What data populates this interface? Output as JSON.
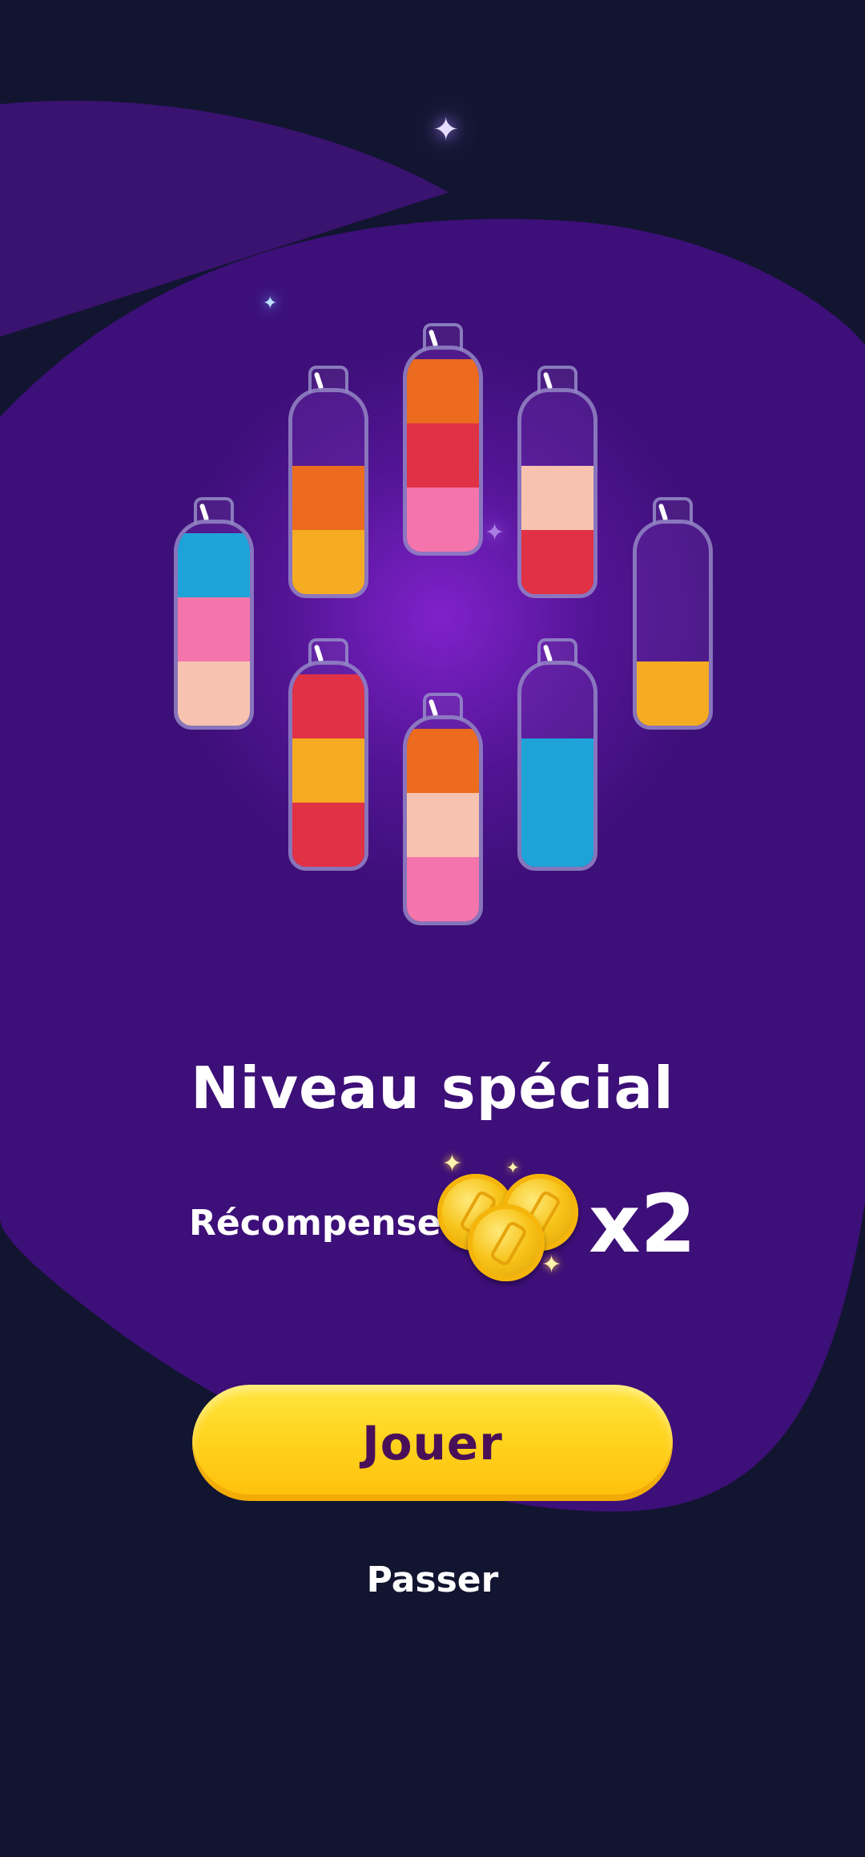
{
  "level": {
    "title": "Niveau spécial",
    "reward_label": "Récompense",
    "reward_multiplier": "x2",
    "reward_icon": "gold-coins-icon"
  },
  "actions": {
    "play_label": "Jouer",
    "skip_label": "Passer"
  },
  "colors": {
    "background": "#121530",
    "blob": "#3d0f78",
    "play_button": "#ffd21c",
    "play_text": "#4a1057",
    "liquid_orange": "#ec6b1e",
    "liquid_red": "#e03145",
    "liquid_pink": "#f474ac",
    "liquid_peach": "#f7c3b0",
    "liquid_yellow": "#f5ac22",
    "liquid_blue": "#1ea3d9"
  },
  "bottles": [
    {
      "id": "top-center",
      "layers_top_to_bottom": [
        "orange",
        "red",
        "pink"
      ]
    },
    {
      "id": "upper-left",
      "layers_top_to_bottom": [
        "orange",
        "yellow"
      ]
    },
    {
      "id": "upper-right",
      "layers_top_to_bottom": [
        "peach",
        "red"
      ]
    },
    {
      "id": "far-left",
      "layers_top_to_bottom": [
        "blue",
        "pink",
        "peach"
      ]
    },
    {
      "id": "far-right",
      "layers_top_to_bottom": [
        "yellow"
      ]
    },
    {
      "id": "lower-left",
      "layers_top_to_bottom": [
        "red",
        "yellow",
        "red"
      ]
    },
    {
      "id": "bottom-center",
      "layers_top_to_bottom": [
        "orange",
        "peach",
        "pink"
      ]
    },
    {
      "id": "lower-right",
      "layers_top_to_bottom": [
        "blue",
        "blue"
      ]
    }
  ]
}
